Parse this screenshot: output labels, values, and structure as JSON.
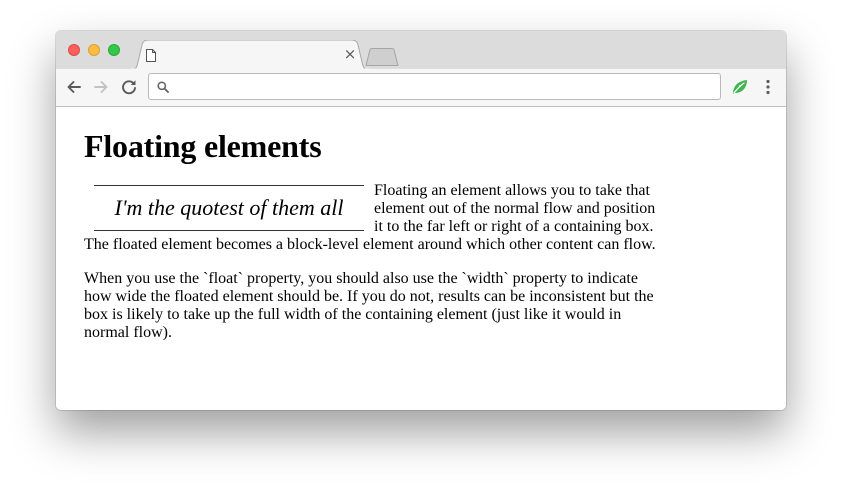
{
  "browser": {
    "tab": {
      "title": "",
      "close_glyph": "×",
      "file_icon": "document-icon"
    },
    "toolbar": {
      "back_icon": "arrow-left-icon",
      "forward_icon": "arrow-right-icon",
      "reload_icon": "reload-icon",
      "address_value": "",
      "address_placeholder": "",
      "search_icon": "magnifier-icon",
      "extension_icon": "green-leaf-extension-icon",
      "menu_icon": "vertical-dots-icon"
    },
    "colors": {
      "close": "#fc605c",
      "minimize": "#fdbc40",
      "maximize": "#34c84a",
      "extension": "#3fb64f"
    }
  },
  "page": {
    "heading": "Floating elements",
    "pullquote": "I'm the quotest of them all",
    "paragraph_1": "Floating an element allows you to take that element out of the normal flow and position it to the far left or right of a containing box. The floated element becomes a block-level element around which other content can flow.",
    "paragraph_2": "When you use the `float` property, you should also use the `width` property to indicate how wide the floated element should be. If you do not, results can be inconsistent but the box is likely to take up the full width of the containing element (just like it would in normal flow)."
  }
}
